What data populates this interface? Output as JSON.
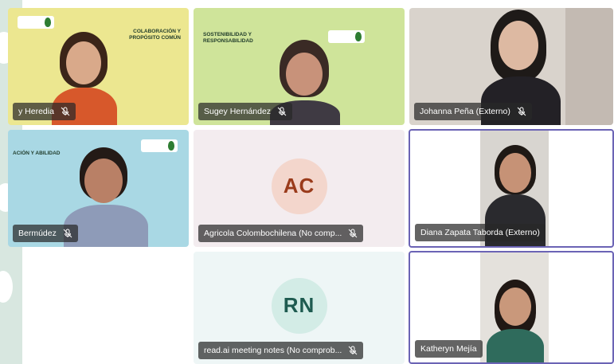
{
  "participants": [
    {
      "name": "Sugey Heredia",
      "display": "y Heredia",
      "type": "video",
      "banner": "COLABORACIÓN Y PROPÓSITO COMÚN",
      "active": false,
      "mic": "muted"
    },
    {
      "name": "Sugey Hernández",
      "display": "Sugey Hernández",
      "type": "video",
      "banner": "SOSTENIBILIDAD Y RESPONSABILIDAD",
      "active": false,
      "mic": "muted"
    },
    {
      "name": "Johanna Peña (Externo)",
      "display": "Johanna Peña (Externo)",
      "type": "video",
      "active": false,
      "mic": "muted"
    },
    {
      "name": "Bermúdez",
      "display": "Bermúdez",
      "type": "video",
      "banner": "ACIÓN Y ABILIDAD",
      "active": false,
      "mic": "muted"
    },
    {
      "name": "Agricola Colombochilena (No comp...",
      "display": "Agricola Colombochilena (No comp...",
      "type": "avatar",
      "initials": "AC",
      "active": false,
      "mic": "muted"
    },
    {
      "name": "Diana Zapata Taborda (Externo)",
      "display": "Diana Zapata Taborda (Externo)",
      "type": "video",
      "active": true,
      "mic": "none"
    },
    {
      "name": "read.ai meeting notes (No comprob...",
      "display": "read.ai meeting notes (No comprob...",
      "type": "avatar",
      "initials": "RN",
      "active": false,
      "mic": "muted"
    },
    {
      "name": "Katheryn Mejía",
      "display": "Katheryn Mejía",
      "type": "video",
      "active": true,
      "mic": "none"
    }
  ],
  "colors": {
    "tile_yellow": "#ece790",
    "tile_green": "#cfe49a",
    "tile_blue": "#a9d8e4",
    "tile_avatar_pink": "#f3ecef",
    "tile_avatar_mint": "#eef6f6",
    "avatar_ac_bg": "#f3d6cc",
    "avatar_ac_fg": "#9a3b1b",
    "avatar_rn_bg": "#d3ece6",
    "avatar_rn_fg": "#1e5b50",
    "active_border": "#6b63b5"
  }
}
